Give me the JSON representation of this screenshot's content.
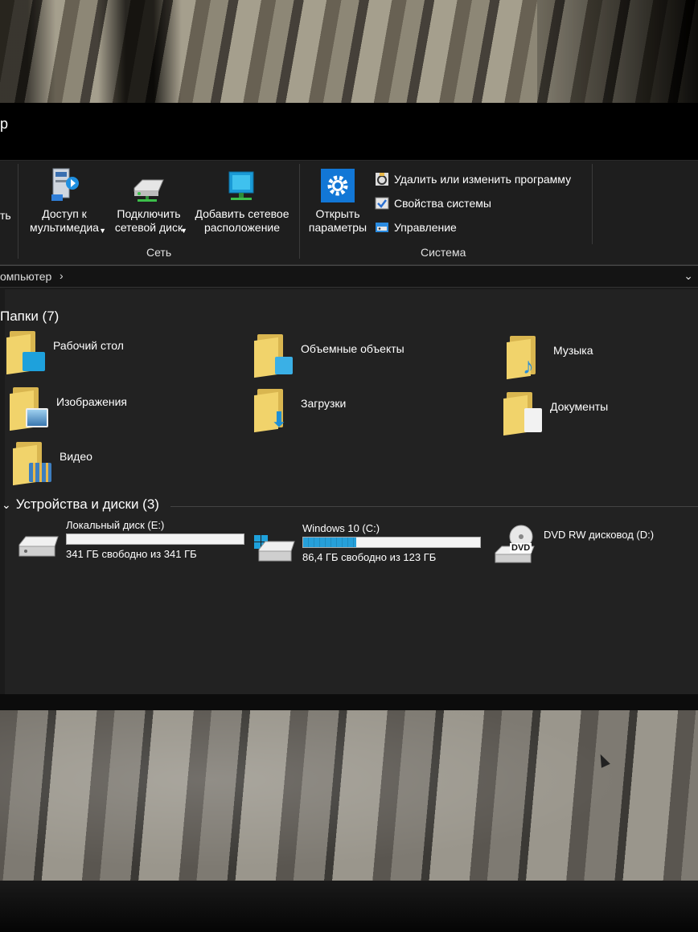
{
  "window": {
    "title": "р"
  },
  "ribbon": {
    "network_group": {
      "label": "Сеть",
      "buttons": [
        {
          "label": "Доступ к\nмультимедиа",
          "icon": "media-access-icon",
          "has_dropdown": true
        },
        {
          "label": "Подключить\nсетевой диск",
          "icon": "network-drive-icon",
          "has_dropdown": true
        },
        {
          "label": "Добавить сетевое\nрасположение",
          "icon": "network-location-icon",
          "has_dropdown": false
        }
      ]
    },
    "system_group": {
      "label": "Система",
      "open_settings": {
        "label": "Открыть\nпараметры",
        "icon": "gear-icon"
      },
      "commands": [
        {
          "label": "Удалить или изменить программу",
          "icon": "uninstall-icon"
        },
        {
          "label": "Свойства системы",
          "icon": "system-properties-icon"
        },
        {
          "label": "Управление",
          "icon": "manage-icon"
        }
      ]
    },
    "partial_left_label": "ть"
  },
  "address": {
    "breadcrumb": "омпьютер",
    "arrow": "›",
    "dropdown": "⌄"
  },
  "folders_section": {
    "title": "Папки (7)",
    "items": [
      {
        "name": "Рабочий стол",
        "icon": "desktop-folder-icon",
        "badge_color": "#1ea1dc"
      },
      {
        "name": "Объемные объекты",
        "icon": "3d-objects-folder-icon",
        "badge_color": "#3ab0e6"
      },
      {
        "name": "Музыка",
        "icon": "music-folder-icon",
        "badge_color": "#2b8fd6"
      },
      {
        "name": "Изображения",
        "icon": "pictures-folder-icon",
        "badge_color": "#6aaed6"
      },
      {
        "name": "Загрузки",
        "icon": "downloads-folder-icon",
        "badge_color": "#1e8fd6"
      },
      {
        "name": "Документы",
        "icon": "documents-folder-icon",
        "badge_color": "#f2f2f2"
      },
      {
        "name": "Видео",
        "icon": "videos-folder-icon",
        "badge_color": "#3d7ec0"
      }
    ]
  },
  "drives_section": {
    "title": "Устройства и диски (3)",
    "chevron": "⌄",
    "items": [
      {
        "name": "Локальный диск (E:)",
        "free": "341 ГБ свободно из 341 ГБ",
        "used_fraction": 0.0,
        "icon": "hard-drive-icon",
        "has_bar": true
      },
      {
        "name": "Windows 10 (C:)",
        "free": "86,4 ГБ свободно из 123 ГБ",
        "used_fraction": 0.3,
        "icon": "windows-drive-icon",
        "has_bar": true
      },
      {
        "name": "DVD RW дисковод (D:)",
        "free": "",
        "icon": "dvd-drive-icon",
        "has_bar": false,
        "icon_text": "DVD"
      }
    ]
  }
}
